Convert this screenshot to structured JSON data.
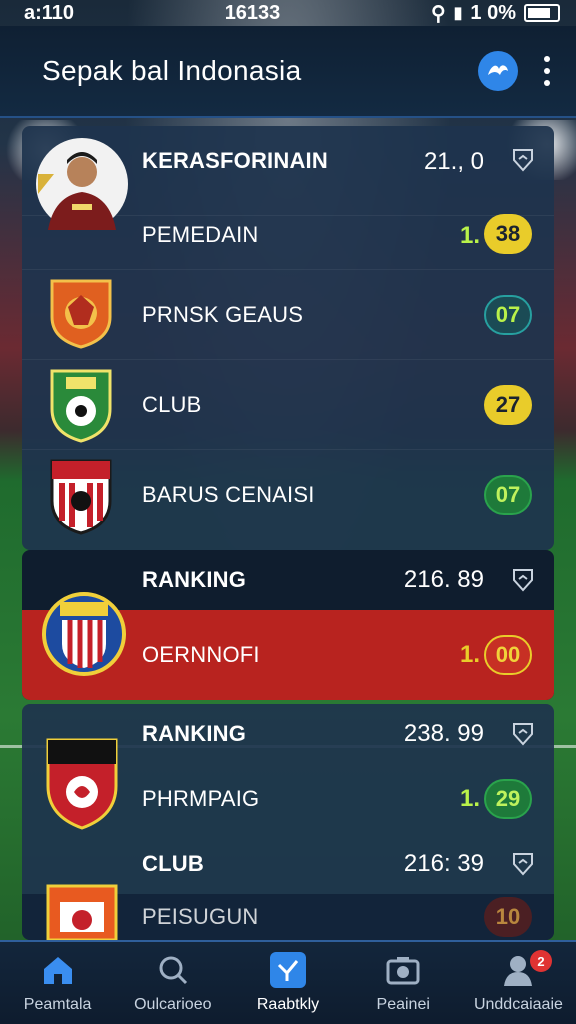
{
  "status_bar": {
    "time": "a:110",
    "center": "16133",
    "battery": "1 0%"
  },
  "header": {
    "title": "Sepak bal Indonasia",
    "logo_icon": "app-logo-icon",
    "menu_icon": "more-vertical-icon"
  },
  "card1": {
    "rows": [
      {
        "label": "KERASFORINAIN",
        "value": "21., 0",
        "icon": "shield-icon"
      },
      {
        "label": "PEMEDAIN",
        "prefix": "1.",
        "score": "38",
        "score_color": "#e9cc2a"
      },
      {
        "label": "PRNSK GEAUS",
        "score": "07",
        "score_color": "#1b4b55"
      },
      {
        "label": "CLUB",
        "score": "27",
        "score_color": "#e9cc2a"
      },
      {
        "label": "BARUS CENAISI",
        "score": "07",
        "score_color": "#1e7a3a"
      }
    ]
  },
  "card2": {
    "rows": [
      {
        "label": "RANKING",
        "value": "216. 89",
        "icon": "shield-icon"
      },
      {
        "label": "OERNNOFI",
        "prefix": "1.",
        "score": "00",
        "score_color": "#e9cc2a"
      }
    ],
    "highlight_color": "#b8231f"
  },
  "card3": {
    "rows": [
      {
        "label": "RANKING",
        "value": "238. 99",
        "icon": "shield-icon"
      },
      {
        "label": "PHRMPAIG",
        "prefix": "1.",
        "score": "29",
        "score_color": "#1e7a3a"
      },
      {
        "label": "CLUB",
        "value": "216: 39",
        "icon": "shield-icon"
      },
      {
        "label": "PEISUGUN",
        "score": "10"
      }
    ]
  },
  "bottom_nav": [
    {
      "label": "Peamtala",
      "icon": "home-icon"
    },
    {
      "label": "Oulcarioeo",
      "icon": "search-icon"
    },
    {
      "label": "Raabtkly",
      "icon": "activity-icon",
      "active": true
    },
    {
      "label": "Peainei",
      "icon": "camera-icon"
    },
    {
      "label": "Unddcaiaaie",
      "icon": "user-icon",
      "badge": "2"
    }
  ]
}
